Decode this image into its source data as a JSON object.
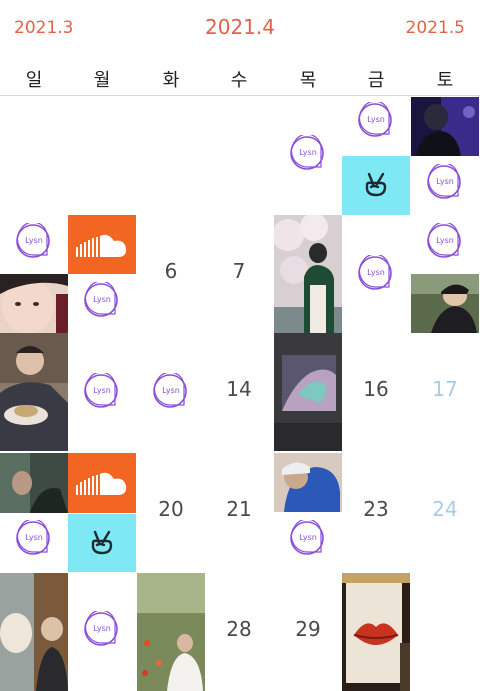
{
  "months": {
    "prev": "2021.3",
    "current": "2021.4",
    "next": "2021.5"
  },
  "weekdays": [
    "일",
    "월",
    "화",
    "수",
    "목",
    "금",
    "토"
  ],
  "badges": {
    "lysn": "Lysn"
  },
  "days": {
    "d6": "6",
    "d7": "7",
    "d14": "14",
    "d16": "16",
    "d17": "17",
    "d20": "20",
    "d21": "21",
    "d23": "23",
    "d24": "24",
    "d28": "28",
    "d29": "29"
  },
  "colors": {
    "accent": "#e0634a",
    "lysn": "#8a4fd8",
    "soundcloud": "#f26522",
    "vlive": "#7ee9f4",
    "saturday": "#a8cce6"
  },
  "icons": {
    "soundcloud": "soundcloud-icon",
    "vlive": "vlive-peace-icon",
    "lysn": "lysn-bubble-icon"
  }
}
